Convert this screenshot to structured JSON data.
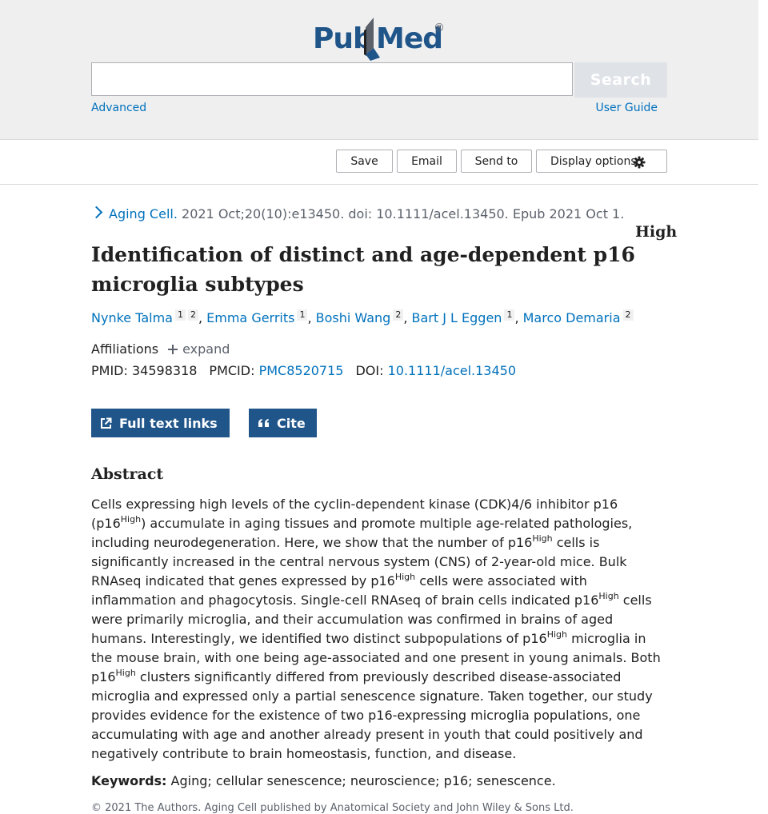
{
  "header": {
    "logo": {
      "part1": "Pub",
      "part2": "Med",
      "reg": "®"
    },
    "search": {
      "value": "",
      "placeholder": "",
      "button": "Search"
    },
    "advanced": "Advanced",
    "user_guide": "User Guide"
  },
  "toolbar": {
    "save": "Save",
    "email": "Email",
    "send_to": "Send to",
    "display_options": "Display options"
  },
  "citation": {
    "journal": "Aging Cell.",
    "details": "2021 Oct;20(10):e13450. doi: 10.1111/acel.13450. Epub 2021 Oct 1."
  },
  "article": {
    "title_part1": "Identification of distinct and age-dependent p16",
    "title_sup": "High",
    "title_part2": "microglia subtypes",
    "authors": [
      {
        "name": "Nynke Talma",
        "affs": [
          "1",
          "2"
        ]
      },
      {
        "name": "Emma Gerrits",
        "affs": [
          "1"
        ]
      },
      {
        "name": "Boshi Wang",
        "affs": [
          "2"
        ]
      },
      {
        "name": "Bart J L Eggen",
        "affs": [
          "1"
        ]
      },
      {
        "name": "Marco Demaria",
        "affs": [
          "2"
        ]
      }
    ],
    "affiliations_label": "Affiliations",
    "expand_label": "expand",
    "pmid_label": "PMID:",
    "pmid": "34598318",
    "pmcid_label": "PMCID:",
    "pmcid": "PMC8520715",
    "doi_label": "DOI:",
    "doi": "10.1111/acel.13450"
  },
  "actions": {
    "full_text": "Full text links",
    "cite": "Cite"
  },
  "abstract": {
    "heading": "Abstract",
    "segments": [
      "Cells expressing high levels of the cyclin-dependent kinase (CDK)4/6 inhibitor p16 (p16",
      ") accumulate in aging tissues and promote multiple age-related pathologies, including neurodegeneration. Here, we show that the number of p16",
      " cells is significantly increased in the central nervous system (CNS) of 2-year-old mice. Bulk RNAseq indicated that genes expressed by p16",
      " cells were associated with inflammation and phagocytosis. Single-cell RNAseq of brain cells indicated p16",
      " cells were primarily microglia, and their accumulation was confirmed in brains of aged humans. Interestingly, we identified two distinct subpopulations of p16",
      " microglia in the mouse brain, with one being age-associated and one present in young animals. Both p16",
      " clusters significantly differed from previously described disease-associated microglia and expressed only a partial senescence signature. Taken together, our study provides evidence for the existence of two p16-expressing microglia populations, one accumulating with age and another already present in youth that could positively and negatively contribute to brain homeostasis, function, and disease."
    ],
    "sup": "High"
  },
  "keywords": {
    "label": "Keywords:",
    "text": "Aging; cellular senescence; neuroscience; p16; senescence."
  },
  "copyright": "© 2021 The Authors. Aging Cell published by Anatomical Society and John Wiley & Sons Ltd."
}
